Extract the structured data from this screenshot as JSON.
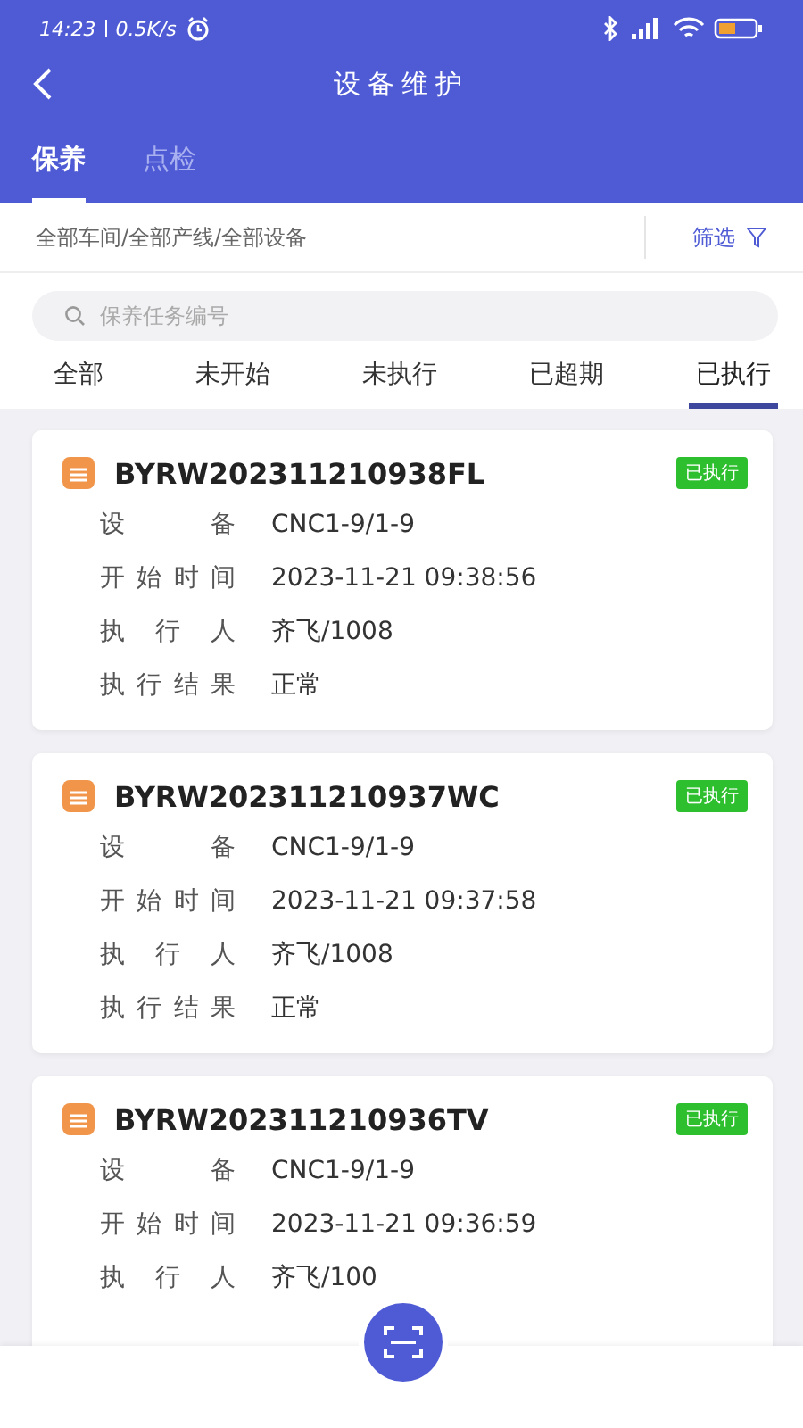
{
  "status_bar": {
    "time": "14:23",
    "speed": "0.5K/s"
  },
  "header": {
    "title": "设备维护"
  },
  "tabs": [
    {
      "label": "保养",
      "selected": true
    },
    {
      "label": "点检",
      "selected": false
    }
  ],
  "filter": {
    "path": "全部车间/全部产线/全部设备",
    "button": "筛选"
  },
  "search": {
    "placeholder": "保养任务编号"
  },
  "status_tabs": [
    {
      "label": "全部",
      "selected": false
    },
    {
      "label": "未开始",
      "selected": false
    },
    {
      "label": "未执行",
      "selected": false
    },
    {
      "label": "已超期",
      "selected": false
    },
    {
      "label": "已执行",
      "selected": true
    }
  ],
  "cards": [
    {
      "code": "BYRW202311210938FL",
      "badge": "已执行",
      "fields": [
        {
          "label": "设备",
          "value": "CNC1-9/1-9"
        },
        {
          "label": "开始时间",
          "value": "2023-11-21 09:38:56"
        },
        {
          "label": "执行人",
          "value": "齐飞/1008"
        },
        {
          "label": "执行结果",
          "value": "正常"
        }
      ]
    },
    {
      "code": "BYRW202311210937WC",
      "badge": "已执行",
      "fields": [
        {
          "label": "设备",
          "value": "CNC1-9/1-9"
        },
        {
          "label": "开始时间",
          "value": "2023-11-21 09:37:58"
        },
        {
          "label": "执行人",
          "value": "齐飞/1008"
        },
        {
          "label": "执行结果",
          "value": "正常"
        }
      ]
    },
    {
      "code": "BYRW202311210936TV",
      "badge": "已执行",
      "fields": [
        {
          "label": "设备",
          "value": "CNC1-9/1-9"
        },
        {
          "label": "开始时间",
          "value": "2023-11-21 09:36:59"
        },
        {
          "label": "执行人",
          "value": "齐飞/100"
        }
      ]
    }
  ]
}
